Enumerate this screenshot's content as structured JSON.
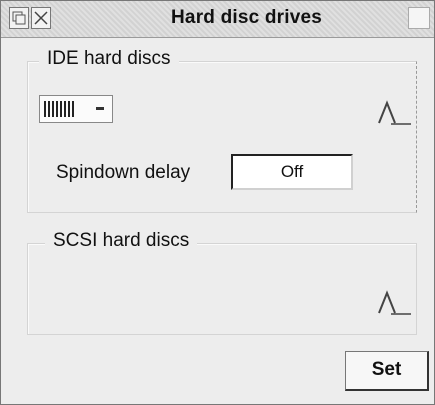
{
  "window": {
    "title": "Hard disc drives"
  },
  "ide_group": {
    "label": "IDE hard discs",
    "drive_icon": "hard-disc-drive-icon",
    "menu_icon": "menu-dash-icon",
    "scroll_icon": "scroll-up-arrow-icon",
    "spindown_label": "Spindown delay",
    "spindown_value": "Off"
  },
  "scsi_group": {
    "label": "SCSI hard discs",
    "scroll_icon": "scroll-up-arrow-icon"
  },
  "actions": {
    "set_label": "Set"
  }
}
